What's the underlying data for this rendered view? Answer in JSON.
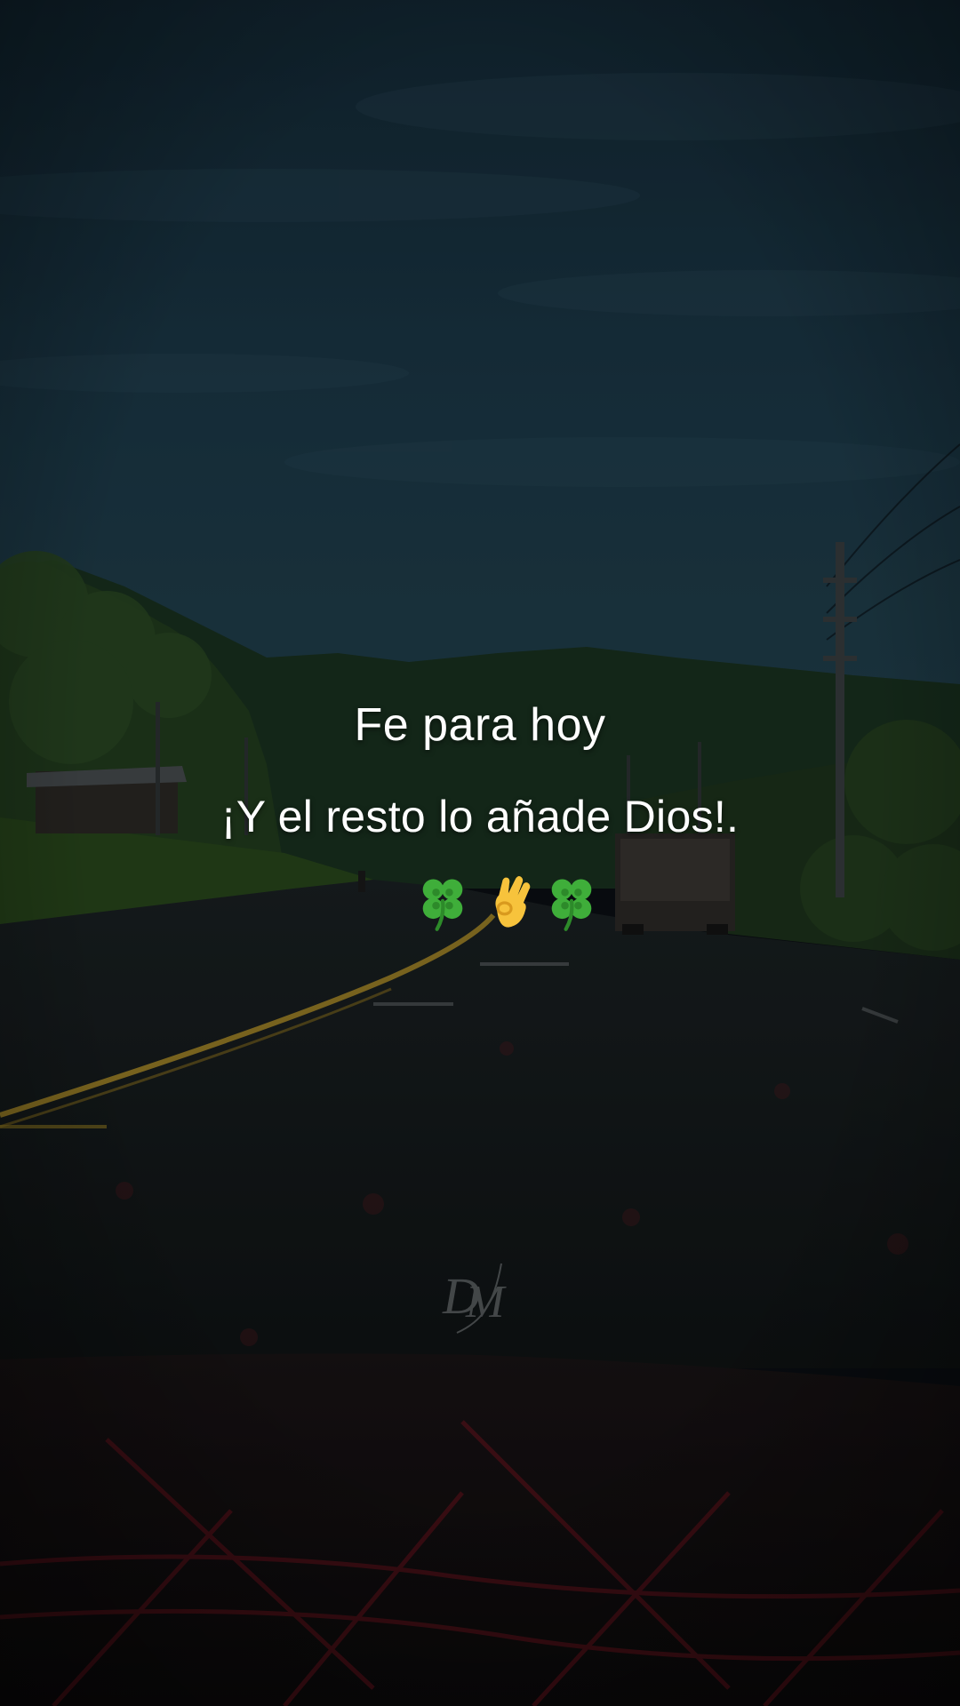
{
  "caption": {
    "line1": "Fe para hoy",
    "line2": "¡Y el resto lo añade Dios!.",
    "emojis": [
      "four-leaf-clover",
      "ok-hand",
      "four-leaf-clover"
    ]
  },
  "watermark": {
    "text": "DM"
  },
  "colors": {
    "sky_top": "#17303f",
    "sky_mid": "#1e3d4c",
    "hills": "#1f3a1c",
    "road": "#161b1d",
    "center_line": "#c9a52a",
    "dashboard_pattern": "#7a1420",
    "caption_text": "#ffffff"
  }
}
